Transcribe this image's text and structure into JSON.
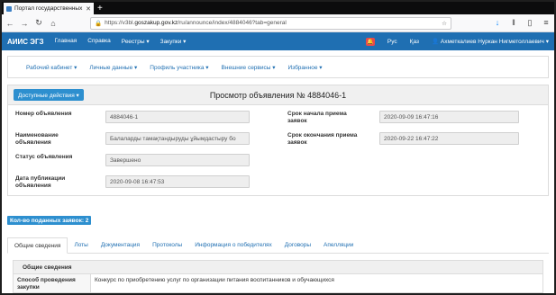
{
  "browser": {
    "tab_title": "Портал государственных зак",
    "url_prefix": "https://v3bl.",
    "url_domain": "goszakup.gov.kz",
    "url_rest": "/ru/announce/index/4884046?tab=general"
  },
  "header": {
    "brand": "АИИС ЭГЗ",
    "menu": [
      "Главная",
      "Справка",
      "Реестры ▾",
      "Закупки ▾"
    ],
    "lang_ru": "Рус",
    "lang_kz": "Қаз",
    "user": "Ахметкалиев Нуркан Нигметоллаевич ▾"
  },
  "submenu": [
    "Рабочий кабинет ▾",
    "Личные данные ▾",
    "Профиль участника ▾",
    "Внешние сервисы ▾",
    "Избранное ▾"
  ],
  "panel": {
    "actions_label": "Доступные действия ▾",
    "title": "Просмотр объявления № 4884046-1",
    "fields": {
      "number_label": "Номер объявления",
      "number_value": "4884046-1",
      "name_label": "Наименование объявления",
      "name_value": "Балаларды тамақтандыруды ұйымдастыру бо",
      "status_label": "Статус объявления",
      "status_value": "Завершено",
      "pubdate_label": "Дата публикации объявления",
      "pubdate_value": "2020-09-08 16:47:53",
      "start_label": "Срок начала приема заявок",
      "start_value": "2020-09-09 16:47:16",
      "end_label": "Срок окончания приема заявок",
      "end_value": "2020-09-22 16:47:22"
    }
  },
  "count_label": "Кол-во поданных заявок: 2",
  "tabs": [
    "Общие сведения",
    "Лоты",
    "Документация",
    "Протоколы",
    "Информация о победителях",
    "Договоры",
    "Апелляции"
  ],
  "general": {
    "header": "Общие сведения",
    "method_label": "Способ проведения закупки",
    "method_value": "Конкурс по приобретению услуг по организации питания воспитанников и обучающихся"
  },
  "colors": {
    "header_bg": "#1f6fb2",
    "button_bg": "#2d8fcf"
  }
}
